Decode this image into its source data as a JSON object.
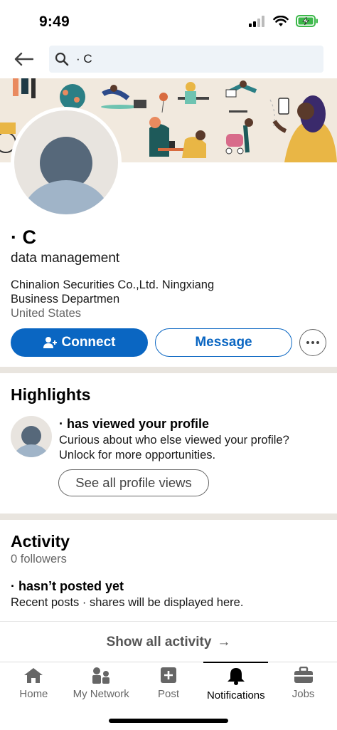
{
  "status_bar": {
    "time": "9:49"
  },
  "search": {
    "query": "· C"
  },
  "profile": {
    "name": "· C",
    "headline": "data management",
    "company": "Chinalion Securities Co.,Ltd. Ningxiang Business Departmen",
    "location": "United States"
  },
  "actions": {
    "connect_label": "Connect",
    "message_label": "Message"
  },
  "highlights": {
    "title": "Highlights",
    "item_title": "· has viewed your profile",
    "item_desc": "Curious about who else viewed your profile? Unlock for more opportunities.",
    "button_label": "See all profile views"
  },
  "activity": {
    "title": "Activity",
    "followers": "0 followers",
    "empty_title": "· hasn’t posted yet",
    "empty_desc": "Recent posts · shares will be displayed here.",
    "show_all_label": "Show all activity",
    "show_all_arrow": "→"
  },
  "nav": {
    "items": [
      {
        "label": "Home",
        "icon": "home-icon"
      },
      {
        "label": "My Network",
        "icon": "network-icon"
      },
      {
        "label": "Post",
        "icon": "post-icon"
      },
      {
        "label": "Notifications",
        "icon": "bell-icon",
        "active": true
      },
      {
        "label": "Jobs",
        "icon": "briefcase-icon"
      }
    ]
  },
  "colors": {
    "accent": "#0a66c2",
    "banner": "#f1e9de",
    "divider": "#e9e5df"
  }
}
